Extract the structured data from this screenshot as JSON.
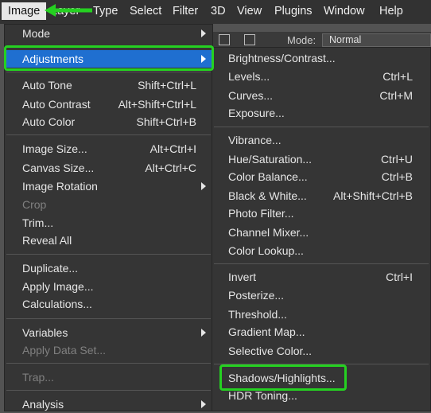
{
  "menubar": {
    "items": [
      "Image",
      "Layer",
      "Type",
      "Select",
      "Filter",
      "3D",
      "View",
      "Plugins",
      "Window",
      "Help"
    ]
  },
  "options_bar": {
    "mode_label": "Mode:",
    "mode_value": "Normal"
  },
  "image_menu": {
    "mode": "Mode",
    "adjustments": "Adjustments",
    "auto_tone": {
      "label": "Auto Tone",
      "shortcut": "Shift+Ctrl+L"
    },
    "auto_contrast": {
      "label": "Auto Contrast",
      "shortcut": "Alt+Shift+Ctrl+L"
    },
    "auto_color": {
      "label": "Auto Color",
      "shortcut": "Shift+Ctrl+B"
    },
    "image_size": {
      "label": "Image Size...",
      "shortcut": "Alt+Ctrl+I"
    },
    "canvas_size": {
      "label": "Canvas Size...",
      "shortcut": "Alt+Ctrl+C"
    },
    "image_rotation": "Image Rotation",
    "crop": "Crop",
    "trim": "Trim...",
    "reveal_all": "Reveal All",
    "duplicate": "Duplicate...",
    "apply_image": "Apply Image...",
    "calculations": "Calculations...",
    "variables": "Variables",
    "apply_data_set": "Apply Data Set...",
    "trap": "Trap...",
    "analysis": "Analysis"
  },
  "adjustments_menu": {
    "brightness_contrast": {
      "label": "Brightness/Contrast..."
    },
    "levels": {
      "label": "Levels...",
      "shortcut": "Ctrl+L"
    },
    "curves": {
      "label": "Curves...",
      "shortcut": "Ctrl+M"
    },
    "exposure": {
      "label": "Exposure..."
    },
    "vibrance": {
      "label": "Vibrance..."
    },
    "hue_saturation": {
      "label": "Hue/Saturation...",
      "shortcut": "Ctrl+U"
    },
    "color_balance": {
      "label": "Color Balance...",
      "shortcut": "Ctrl+B"
    },
    "black_white": {
      "label": "Black & White...",
      "shortcut": "Alt+Shift+Ctrl+B"
    },
    "photo_filter": {
      "label": "Photo Filter..."
    },
    "channel_mixer": {
      "label": "Channel Mixer..."
    },
    "color_lookup": {
      "label": "Color Lookup..."
    },
    "invert": {
      "label": "Invert",
      "shortcut": "Ctrl+I"
    },
    "posterize": {
      "label": "Posterize..."
    },
    "threshold": {
      "label": "Threshold..."
    },
    "gradient_map": {
      "label": "Gradient Map..."
    },
    "selective_color": {
      "label": "Selective Color..."
    },
    "shadows_highlights": {
      "label": "Shadows/Highlights..."
    },
    "hdr_toning": {
      "label": "HDR Toning..."
    }
  },
  "colors": {
    "highlight": "#1f6fd0",
    "annotation": "#25d121",
    "menu_bg": "#353535"
  }
}
